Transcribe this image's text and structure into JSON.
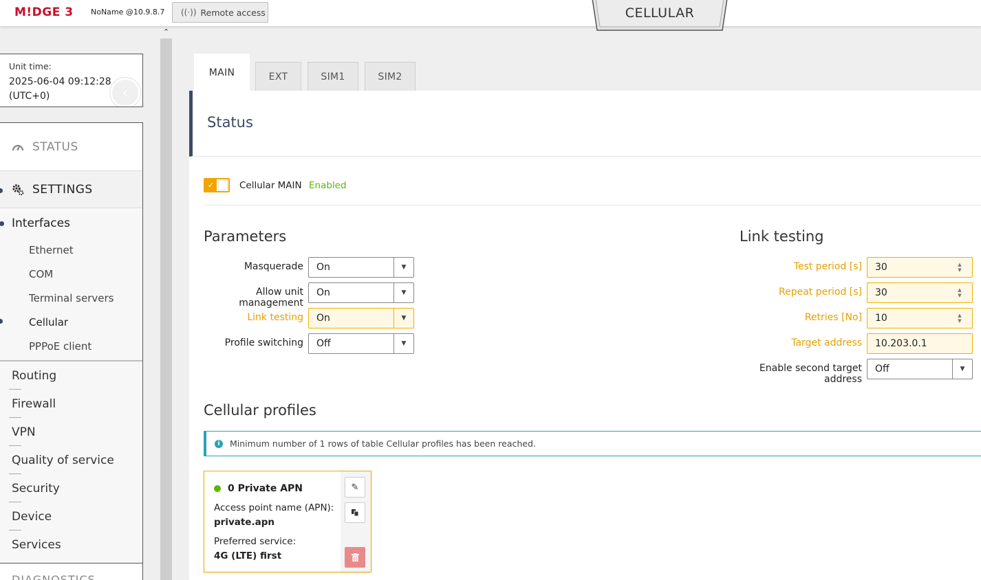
{
  "header": {
    "logo": "M!DGE 3",
    "host": "NoName @10.9.8.7",
    "remote_access": "Remote access",
    "page_title": "CELLULAR"
  },
  "sidebar": {
    "unit_time_label": "Unit time:",
    "unit_time_value": "2025-06-04 09:12:28",
    "unit_time_tz": "(UTC+0)",
    "status": "STATUS",
    "settings": "SETTINGS",
    "interfaces": "Interfaces",
    "interface_items": [
      "Ethernet",
      "COM",
      "Terminal servers",
      "Cellular",
      "PPPoE client"
    ],
    "menu_items": [
      "Routing",
      "Firewall",
      "VPN",
      "Quality of service",
      "Security",
      "Device",
      "Services"
    ],
    "diagnostics": "DIAGNOSTICS"
  },
  "tabs": [
    "MAIN",
    "EXT",
    "SIM1",
    "SIM2"
  ],
  "status_section": {
    "title": "Status",
    "toggle_label": "Cellular MAIN",
    "toggle_state": "Enabled"
  },
  "parameters": {
    "title": "Parameters",
    "fields": [
      {
        "label": "Masquerade",
        "value": "On"
      },
      {
        "label": "Allow unit management",
        "value": "On"
      },
      {
        "label": "Link testing",
        "value": "On"
      },
      {
        "label": "Profile switching",
        "value": "Off"
      }
    ]
  },
  "link_testing": {
    "title": "Link testing",
    "fields": [
      {
        "label": "Test period [s]",
        "value": "30"
      },
      {
        "label": "Repeat period [s]",
        "value": "30"
      },
      {
        "label": "Retries [No]",
        "value": "10"
      },
      {
        "label": "Target address",
        "value": "10.203.0.1"
      },
      {
        "label": "Enable second target address",
        "value": "Off"
      }
    ]
  },
  "profiles": {
    "title": "Cellular profiles",
    "info": "Minimum number of 1 rows of table Cellular profiles has been reached.",
    "card": {
      "name": "0 Private APN",
      "apn_label": "Access point name (APN):",
      "apn_value": "private.apn",
      "service_label": "Preferred service:",
      "service_value": "4G (LTE) first"
    }
  },
  "colors": {
    "accent": "#f0a500",
    "navy": "#3c4a60",
    "enabled": "#5cb800",
    "info": "#2aa3b6",
    "brand": "#c8102e"
  }
}
